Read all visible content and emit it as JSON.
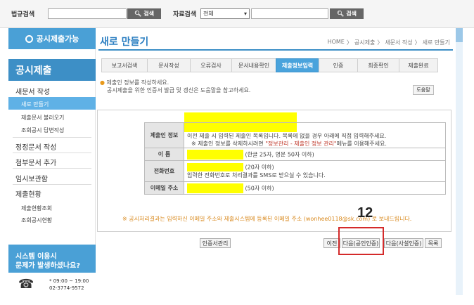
{
  "topbar": {
    "search_label": "법규검색",
    "search_button": "검색",
    "data_label": "자료검색",
    "data_select": "전체",
    "data_button": "검색"
  },
  "sidebar": {
    "status_button": "공시제출가능",
    "heading": "공시제출",
    "sections": [
      {
        "label": "새문서 작성",
        "subs": [
          "새로 만들기",
          "제출문서 불러오기",
          "조회공시 답변작성"
        ]
      },
      {
        "label": "정정문서 작성",
        "subs": []
      },
      {
        "label": "첨부문서 추가",
        "subs": []
      },
      {
        "label": "임시보관함",
        "subs": []
      },
      {
        "label": "제출현황",
        "subs": [
          "제출현황조회",
          "조회공시현황"
        ]
      }
    ],
    "help_title_1": "시스템 이용시",
    "help_title_2": "문제가 발생하셨나요?",
    "help_hours": "* 09:00 ~ 19:00",
    "help_phone": "02-3774-9572"
  },
  "main": {
    "title": "새로 만들기",
    "breadcrumb": [
      "HOME",
      "공시제출",
      "새문서 작성",
      "새로 만들기"
    ],
    "steps": [
      "보고서검색",
      "문서작성",
      "오류검사",
      "문서내용확인",
      "제출정보입력",
      "인증",
      "최종확인",
      "제출완료"
    ],
    "active_step": 4,
    "info_line1": "제출인 정보를 작성하세요.",
    "info_line2": "공시제출을 위한 인증서 발급 및 갱신은 도움말을 참고하세요.",
    "help_button": "도움말",
    "form": {
      "submitter_label": "제출인 정보",
      "submitter_note1": "이전 제출 시 입력된 제출인 목록입니다. 목록에 없을 경우 아래에 직접 입력해주세요.",
      "submitter_note2_a": "※ 제출인 정보를 삭제하시려면 ",
      "submitter_note2_b": "\"정보관리 - 제출인 정보 관리\"",
      "submitter_note2_c": "메뉴를 이용해주세요.",
      "name_label": "이 름",
      "name_hint": "(한글 25자, 영문 50자 이하)",
      "phone_label": "전화번호",
      "phone_hint": "(20자 이하)",
      "phone_note": "입력한 전화번호로 처리결과를 SMS로 받으실 수 있습니다.",
      "email_label": "이메일 주소",
      "email_hint": "(50자 이하)"
    },
    "notice": "※ 공시처리결과는 입력하신 이메일 주소와 제출시스템에 등록된 이메일 주소 (wonhee0118@sk.com) 로 보내드립니다.",
    "buttons": {
      "cert_manage": "인증서관리",
      "prev": "이전",
      "next_public": "다음(공인인증)",
      "next_private": "다음(사설인증)",
      "list": "목록"
    },
    "annotation": "12"
  }
}
